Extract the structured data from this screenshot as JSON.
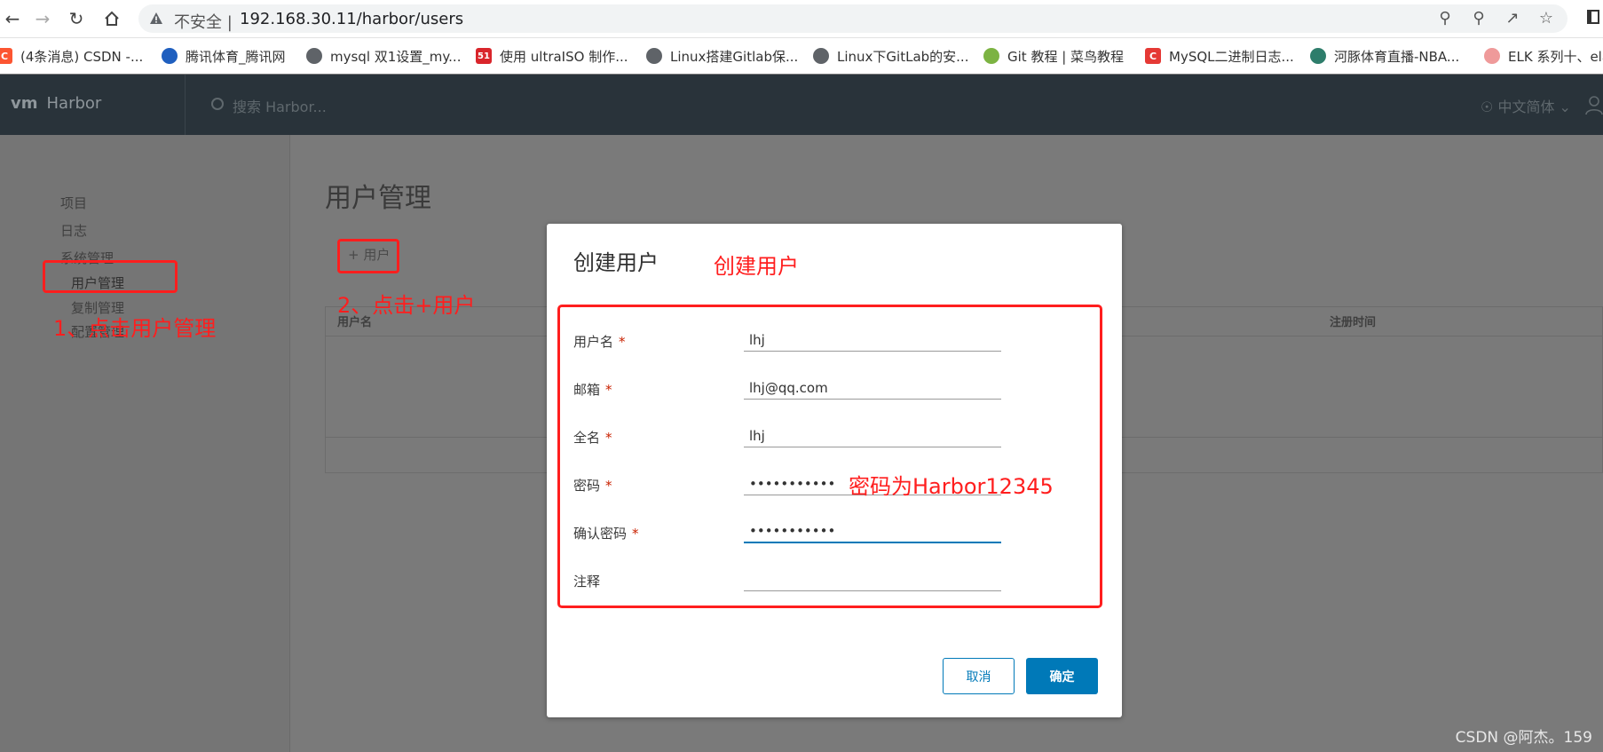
{
  "browser": {
    "insecure_label": "不安全 |",
    "url": "192.168.30.11/harbor/users"
  },
  "bookmarks": [
    {
      "icon": "C",
      "label": "(4条消息) CSDN -..."
    },
    {
      "icon": "",
      "label": "腾讯体育_腾讯网"
    },
    {
      "icon": "",
      "label": "mysql 双1设置_my..."
    },
    {
      "icon": "51",
      "label": "使用 ultraISO 制作..."
    },
    {
      "icon": "",
      "label": "Linux搭建Gitlab保..."
    },
    {
      "icon": "",
      "label": "Linux下GitLab的安..."
    },
    {
      "icon": "",
      "label": "Git 教程 | 菜鸟教程"
    },
    {
      "icon": "C",
      "label": "MySQL二进制日志..."
    },
    {
      "icon": "",
      "label": "河豚体育直播-NBA..."
    },
    {
      "icon": "",
      "label": "ELK 系列十、ela"
    }
  ],
  "header": {
    "logo_mark": "vm",
    "logo_text": "Harbor",
    "search_placeholder": "搜索 Harbor...",
    "language": "中文简体 ⌄"
  },
  "sidebar": {
    "items": [
      "项目",
      "日志",
      "系统管理",
      "用户管理",
      "复制管理",
      "配置管理"
    ]
  },
  "main": {
    "title": "用户管理",
    "add_user": "+ 用户",
    "columns": [
      "用户名",
      "注册时间"
    ]
  },
  "annotations": {
    "step1": "1、点击用户管理",
    "step2": "2、点击+用户",
    "create_user": "创建用户",
    "password_note": "密码为Harbor12345"
  },
  "modal": {
    "title": "创建用户",
    "fields": [
      {
        "label": "用户名",
        "required": "*",
        "value": "lhj"
      },
      {
        "label": "邮箱",
        "required": "*",
        "value": "lhj@qq.com"
      },
      {
        "label": "全名",
        "required": "*",
        "value": "lhj"
      },
      {
        "label": "密码",
        "required": "*",
        "value": "Harbor12345"
      },
      {
        "label": "确认密码",
        "required": "*",
        "value": "Harbor12345"
      },
      {
        "label": "注释",
        "required": "",
        "value": ""
      }
    ],
    "cancel": "取消",
    "confirm": "确定"
  },
  "watermark": "CSDN @阿杰。159",
  "colors": {
    "accent": "#0079b8",
    "annotation": "#ff1e1e",
    "header_bg": "#29333a"
  }
}
